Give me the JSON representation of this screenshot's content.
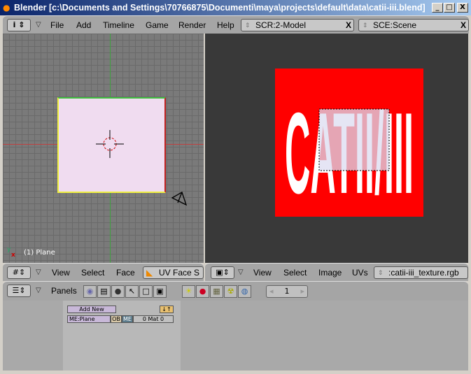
{
  "window": {
    "title": "Blender [c:\\Documents and Settings\\70766875\\Documenti\\maya\\projects\\default\\data\\catii-iii.blend]",
    "min": "_",
    "max": "□",
    "close": "X"
  },
  "menu": {
    "items": [
      "File",
      "Add",
      "Timeline",
      "Game",
      "Render",
      "Help"
    ],
    "screen": "SCR:2-Model",
    "scene": "SCE:Scene"
  },
  "viewport": {
    "object_label": "(1) Plane",
    "axis_y": "y",
    "axis_x": "x",
    "colors": {
      "bg": "#7a7a7a",
      "face": "#f0dcf0",
      "x_axis": "#c04040",
      "y_axis": "#40a040"
    },
    "header": {
      "items": [
        "View",
        "Select",
        "Face"
      ],
      "mode": "UV Face S"
    }
  },
  "image_editor": {
    "texture_text": "CATII/III",
    "texture_bg": "#ff0000",
    "header": {
      "items": [
        "View",
        "Select",
        "Image",
        "UVs"
      ],
      "image": ":catii-iii_texture.rgb"
    }
  },
  "buttons": {
    "panels_label": "Panels",
    "frame": "1",
    "add_new": "Add New",
    "mesh": "ME:Plane",
    "ob": "OB",
    "me": "ME",
    "mat": "0 Mat 0"
  }
}
